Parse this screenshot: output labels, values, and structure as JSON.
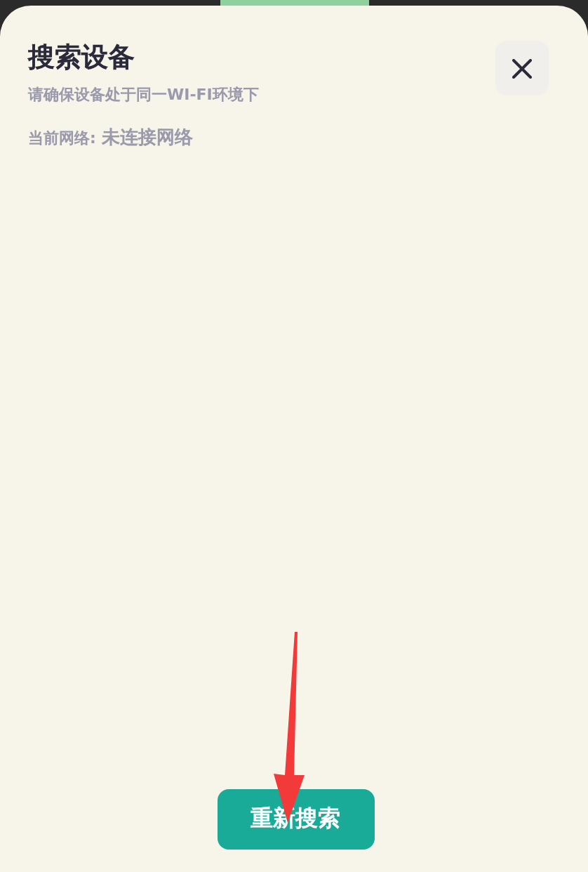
{
  "sheet": {
    "title": "搜索设备",
    "subtitle": "请确保设备处于同一WI-FI环境下",
    "network_label": "当前网络:",
    "network_value": "未连接网络"
  },
  "button": {
    "label": "重新搜索"
  }
}
